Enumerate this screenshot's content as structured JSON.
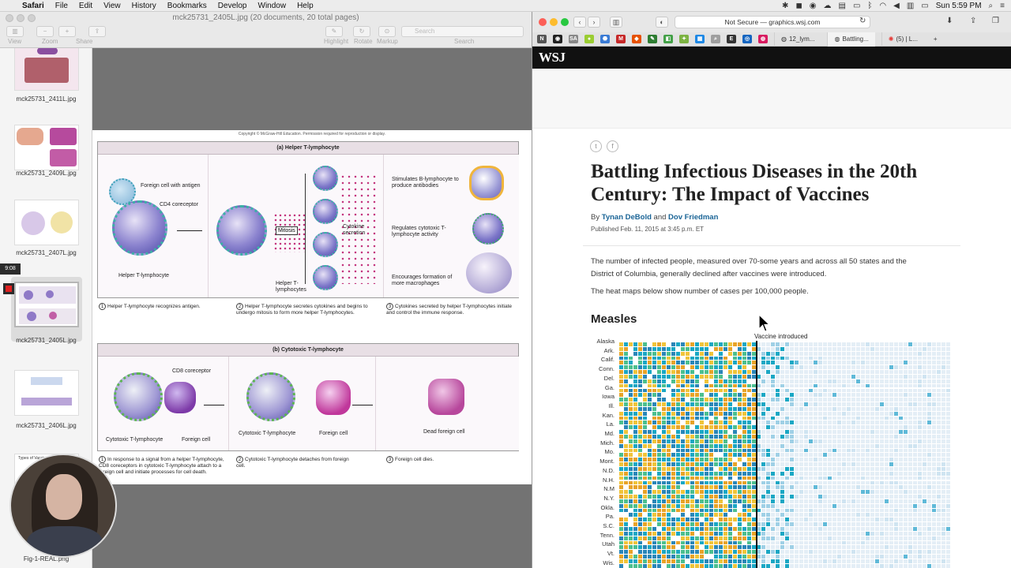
{
  "menubar": {
    "app": "Safari",
    "items": [
      "File",
      "Edit",
      "View",
      "History",
      "Bookmarks",
      "Develop",
      "Window",
      "Help"
    ],
    "clock": "Sun 5:59 PM"
  },
  "preview": {
    "title": "mck25731_2405L.jpg (20 documents, 20 total pages)",
    "toolbar_labels": {
      "view": "View",
      "zoom": "Zoom",
      "share": "Share",
      "highlight": "Highlight",
      "rotate": "Rotate",
      "markup": "Markup",
      "search": "Search"
    },
    "search_placeholder": "Search",
    "thumbnails": [
      {
        "label": "mck25731_2411L.jpg"
      },
      {
        "label": "mck25731_2409L.jpg"
      },
      {
        "label": "mck25731_2407L.jpg"
      },
      {
        "label": "mck25731_2405L.jpg"
      },
      {
        "label": "mck25731_2406L.jpg"
      },
      {
        "label": "Fig-1-REAL.png"
      }
    ],
    "rec_time": "9:08",
    "partial_thumb_text": "Types of Vaccines",
    "page": {
      "copyright": "Copyright © McGraw-Hill Education. Permission required for reproduction or display.",
      "panel_a": {
        "title": "(a) Helper T-lymphocyte",
        "labels": {
          "foreign_cell": "Foreign cell with antigen",
          "cd4": "CD4 coreceptor",
          "helper": "Helper T-lymphocyte",
          "mitosis": "Mitosis",
          "helper_plural": "Helper T-lymphocytes",
          "cytokine": "Cytokine secretion",
          "stim": "Stimulates B-lymphocyte to produce antibodies",
          "regulates": "Regulates cytotoxic T-lymphocyte activity",
          "encourages": "Encourages formation of more macrophages"
        },
        "steps": [
          {
            "num": "1",
            "text": "Helper T-lymphocyte recognizes antigen."
          },
          {
            "num": "2",
            "text": "Helper T-lymphocyte secretes cytokines and begins to undergo mitosis to form more helper T-lymphocytes."
          },
          {
            "num": "3",
            "text": "Cytokines secreted by helper T-lymphocytes initiate and control the immune response."
          }
        ]
      },
      "panel_b": {
        "title": "(b) Cytotoxic T-lymphocyte",
        "labels": {
          "cd8": "CD8 coreceptor",
          "cyto1": "Cytotoxic T-lymphocyte",
          "foreign1": "Foreign cell",
          "cyto2": "Cytotoxic T-lymphocyte",
          "foreign2": "Foreign cell",
          "dead": "Dead foreign cell"
        },
        "steps": [
          {
            "num": "1",
            "text": "In response to a signal from a helper T-lymphocyte, CD8 coreceptors in cytotoxic T-lymphocyte attach to a foreign cell and initiate processes for cell death."
          },
          {
            "num": "2",
            "text": "Cytotoxic T-lymphocyte detaches from foreign cell."
          },
          {
            "num": "3",
            "text": "Foreign cell dies."
          }
        ]
      }
    }
  },
  "safari": {
    "url": "Not Secure — graphics.wsj.com",
    "bookmarks": [
      "N",
      "◉",
      "SA",
      "●",
      "⬣",
      "M",
      "◆",
      "✎",
      "◧",
      "✦",
      "▦",
      "⌕",
      "E",
      "◎",
      "◍"
    ],
    "tabs": [
      {
        "label": "12_lym..."
      },
      {
        "label": "Battling..."
      },
      {
        "label": "(5) | L..."
      }
    ],
    "wsj_logo": "WSJ",
    "share_icons": [
      "twitter-icon",
      "facebook-icon"
    ],
    "headline": "Battling Infectious Diseases in the 20th Century: The Impact of Vaccines",
    "byline_prefix": "By",
    "author1": "Tynan DeBold",
    "byline_and": "and",
    "author2": "Dov Friedman",
    "published": "Published Feb. 11, 2015 at 3:45 p.m. ET",
    "para1": "The number of infected people, measured over 70-some years and across all 50 states and the District of Columbia, generally declined after vaccines were introduced.",
    "para2": "The heat maps below show number of cases per 100,000 people.",
    "section": "Measles",
    "vaccine_label": "Vaccine introduced",
    "states": [
      "Alaska",
      "Ark.",
      "Calif.",
      "Conn.",
      "Del.",
      "Ga.",
      "Iowa",
      "Ill.",
      "Kan.",
      "La.",
      "Md.",
      "Mich.",
      "Mo.",
      "Mont.",
      "N.D.",
      "N.H.",
      "N.M",
      "N.Y.",
      "Okla.",
      "Pa.",
      "S.C.",
      "Tenn.",
      "Utah",
      "Vt.",
      "Wis."
    ]
  },
  "colors": {
    "low": "#e4eef6",
    "mid": "#1aa7c4",
    "midhigh": "#4cbf8f",
    "high": "#f0c43a",
    "veryhigh": "#e8a328",
    "link": "#1a6496"
  }
}
